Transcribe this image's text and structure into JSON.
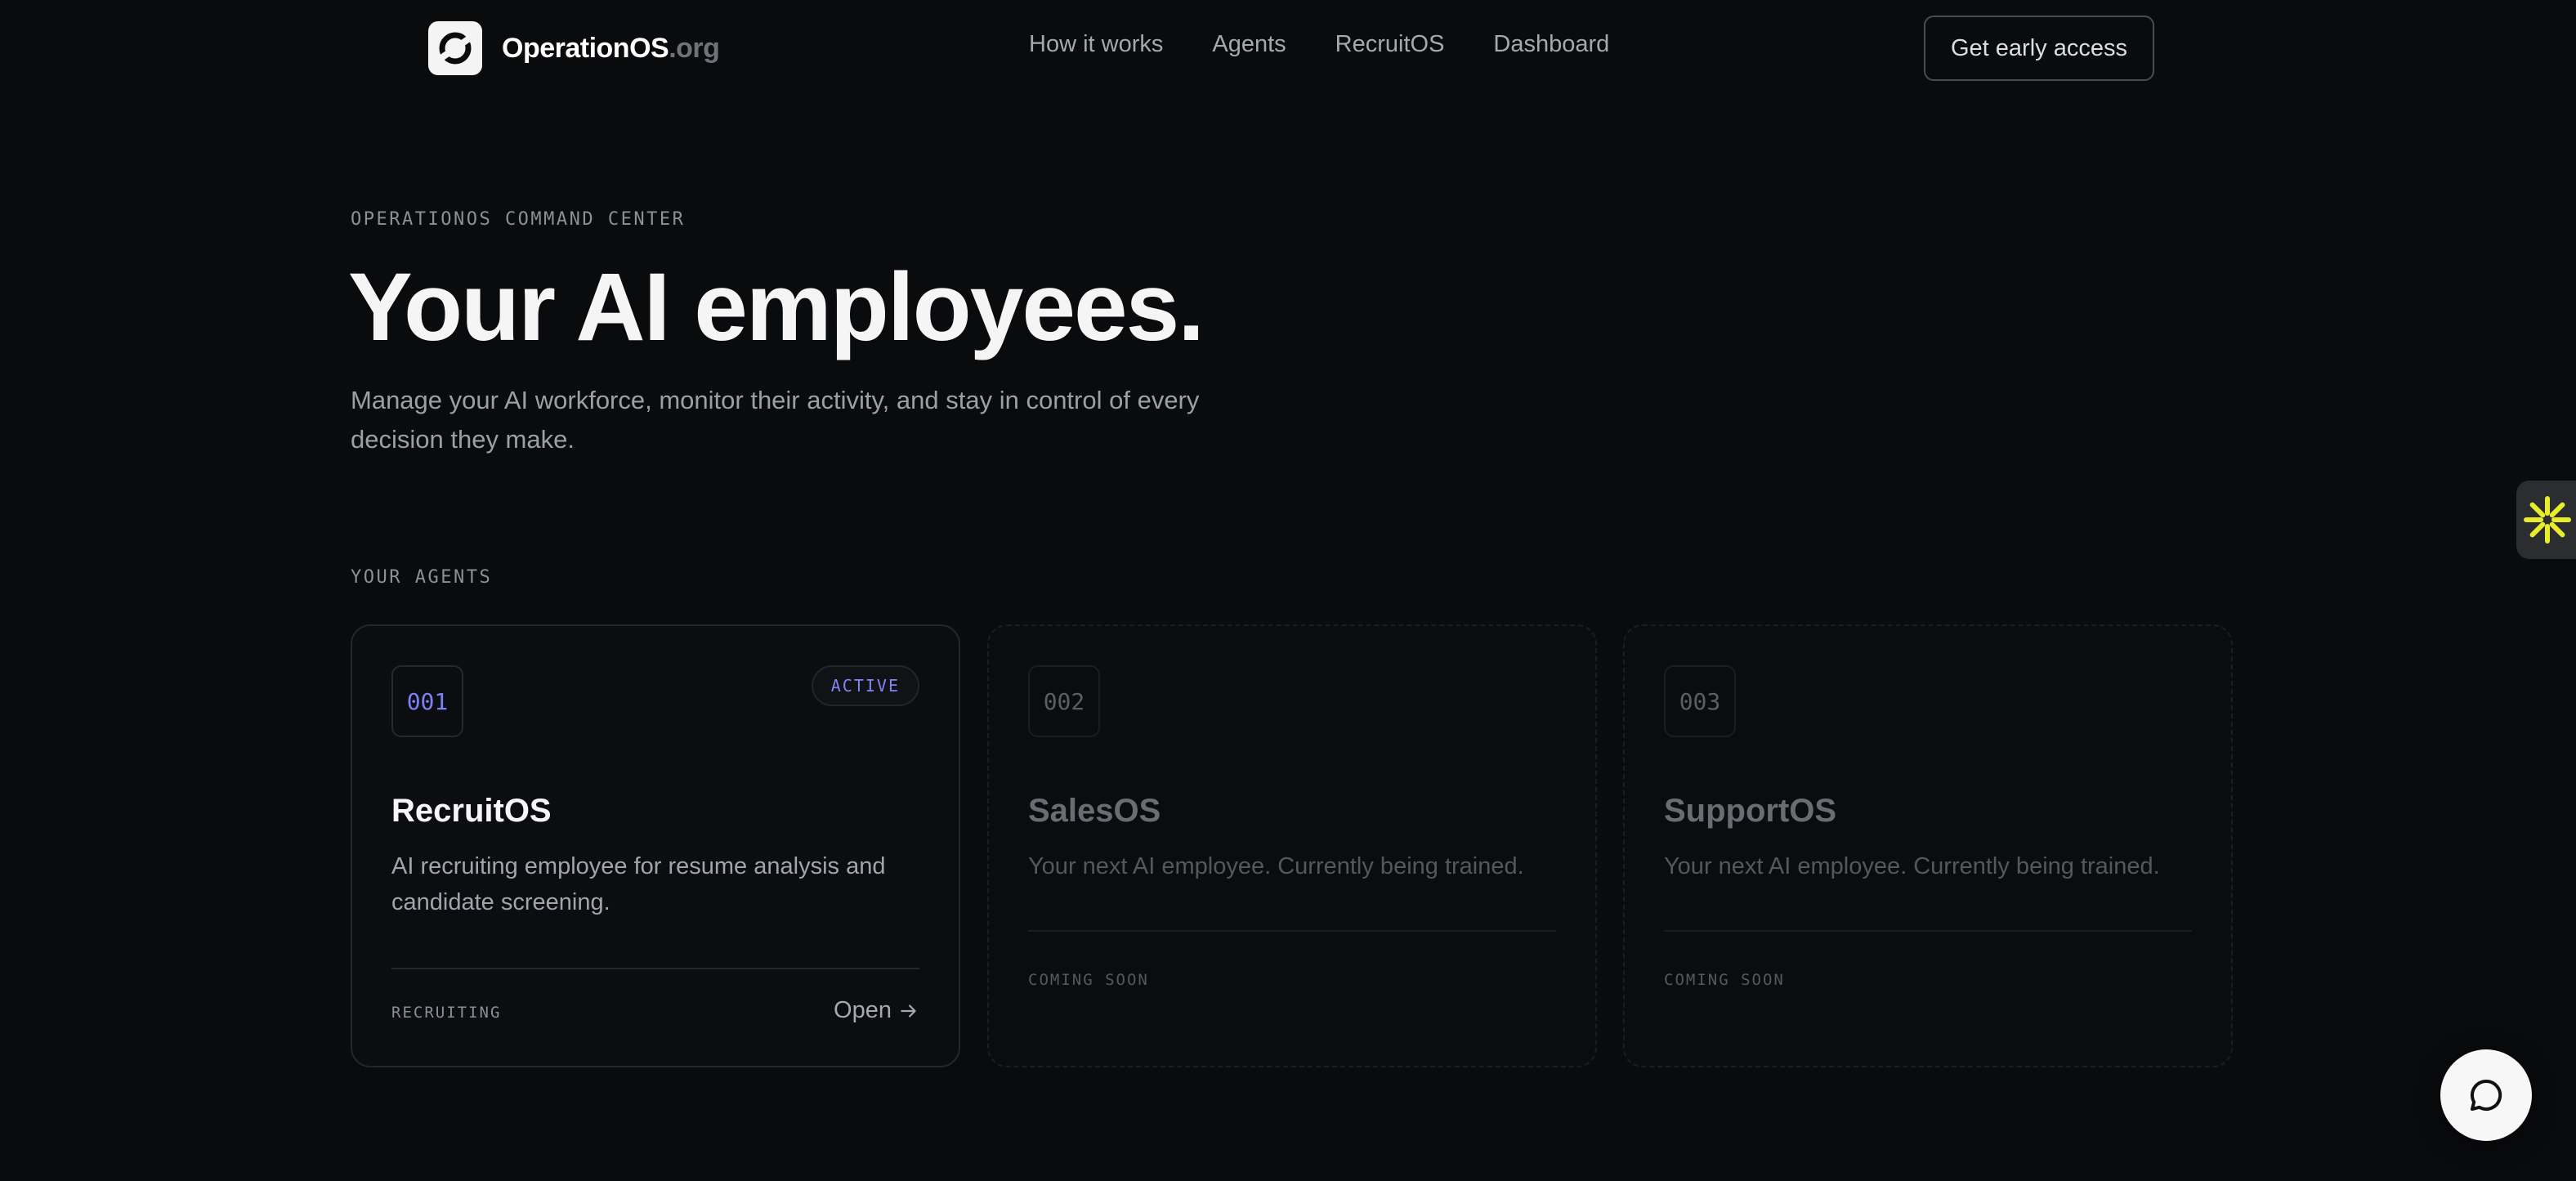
{
  "nav": {
    "brand_name": "OperationOS",
    "brand_tld": ".org",
    "links": [
      "How it works",
      "Agents",
      "RecruitOS",
      "Dashboard"
    ],
    "cta": "Get early access"
  },
  "hero": {
    "eyebrow": "OPERATIONOS COMMAND CENTER",
    "title": "Your AI employees.",
    "subtitle": "Manage your AI workforce, monitor their activity, and stay in control of every decision they make."
  },
  "agents": {
    "section_label": "YOUR AGENTS",
    "cards": [
      {
        "number": "001",
        "status": "ACTIVE",
        "title": "RecruitOS",
        "description": "AI recruiting employee for resume analysis and candidate screening.",
        "footer_label": "RECRUITING",
        "action": "Open"
      },
      {
        "number": "002",
        "title": "SalesOS",
        "description": "Your next AI employee. Currently being trained.",
        "footer_label": "COMING SOON"
      },
      {
        "number": "003",
        "title": "SupportOS",
        "description": "Your next AI employee. Currently being trained.",
        "footer_label": "COMING SOON"
      }
    ]
  },
  "colors": {
    "background": "#0a0b0d",
    "accent": "#7b82f5",
    "widget_yellow": "#e8ec2a"
  },
  "icons": {
    "logo": "operationos-logo-icon",
    "side_widget": "asterisk-icon",
    "chat": "chat-bubble-icon",
    "arrow": "arrow-right-icon"
  }
}
